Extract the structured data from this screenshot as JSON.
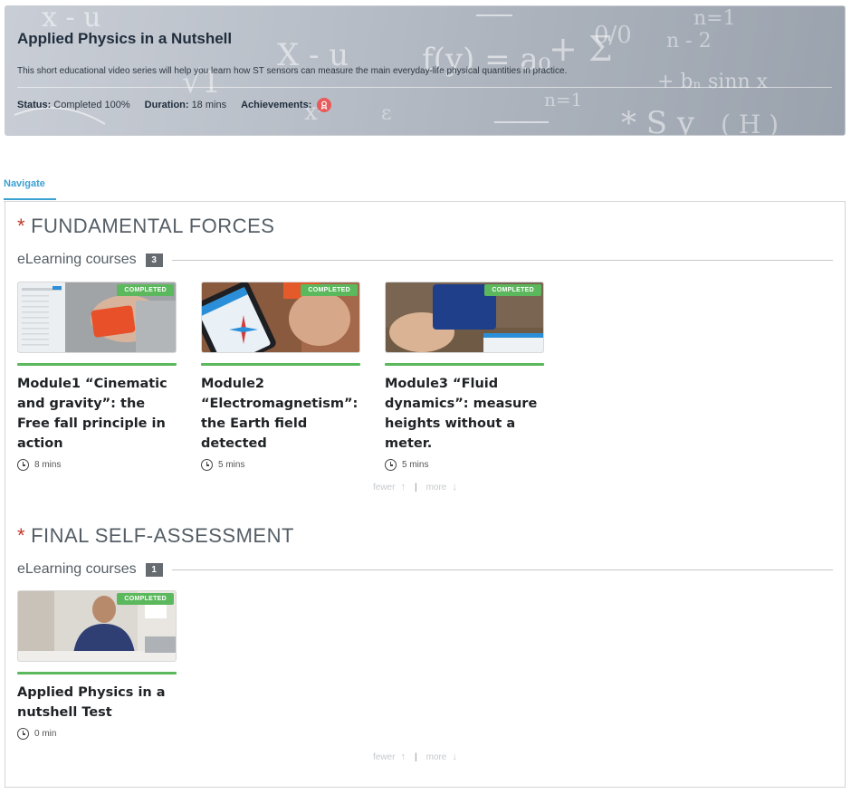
{
  "header": {
    "title": "Applied Physics in a Nutshell",
    "description": "This short educational video series will help you learn how ST sensors can measure the main everyday-life physical quantities in practice.",
    "status_label": "Status:",
    "status_value": "Completed 100%",
    "duration_label": "Duration:",
    "duration_value": "18 mins",
    "achievements_label": "Achievements:",
    "achievement_icon": "award-ribbon-icon"
  },
  "tabs": [
    {
      "label": "Navigate",
      "active": true
    }
  ],
  "sections": [
    {
      "title": "FUNDAMENTAL FORCES",
      "subhead": "eLearning courses",
      "count": "3",
      "courses": [
        {
          "badge": "COMPLETED",
          "title": "Module1 “Cinematic and gravity”: the Free fall principle in action",
          "duration": "8 mins"
        },
        {
          "badge": "COMPLETED",
          "title": "Module2 “Electromagnetism”: the Earth field detected",
          "duration": "5 mins"
        },
        {
          "badge": "COMPLETED",
          "title": "Module3 “Fluid dynamics”: measure heights without a meter.",
          "duration": "5 mins"
        }
      ],
      "pager": {
        "fewer": "fewer",
        "more": "more"
      }
    },
    {
      "title": "FINAL SELF-ASSESSMENT",
      "subhead": "eLearning courses",
      "count": "1",
      "courses": [
        {
          "badge": "COMPLETED",
          "title": "Applied Physics in a nutshell Test",
          "duration": "0 min"
        }
      ],
      "pager": {
        "fewer": "fewer",
        "more": "more"
      }
    }
  ],
  "colors": {
    "accent": "#3aa1d3",
    "completed": "#5cb85c",
    "star": "#c0392b",
    "achievement": "#e85b5b"
  }
}
